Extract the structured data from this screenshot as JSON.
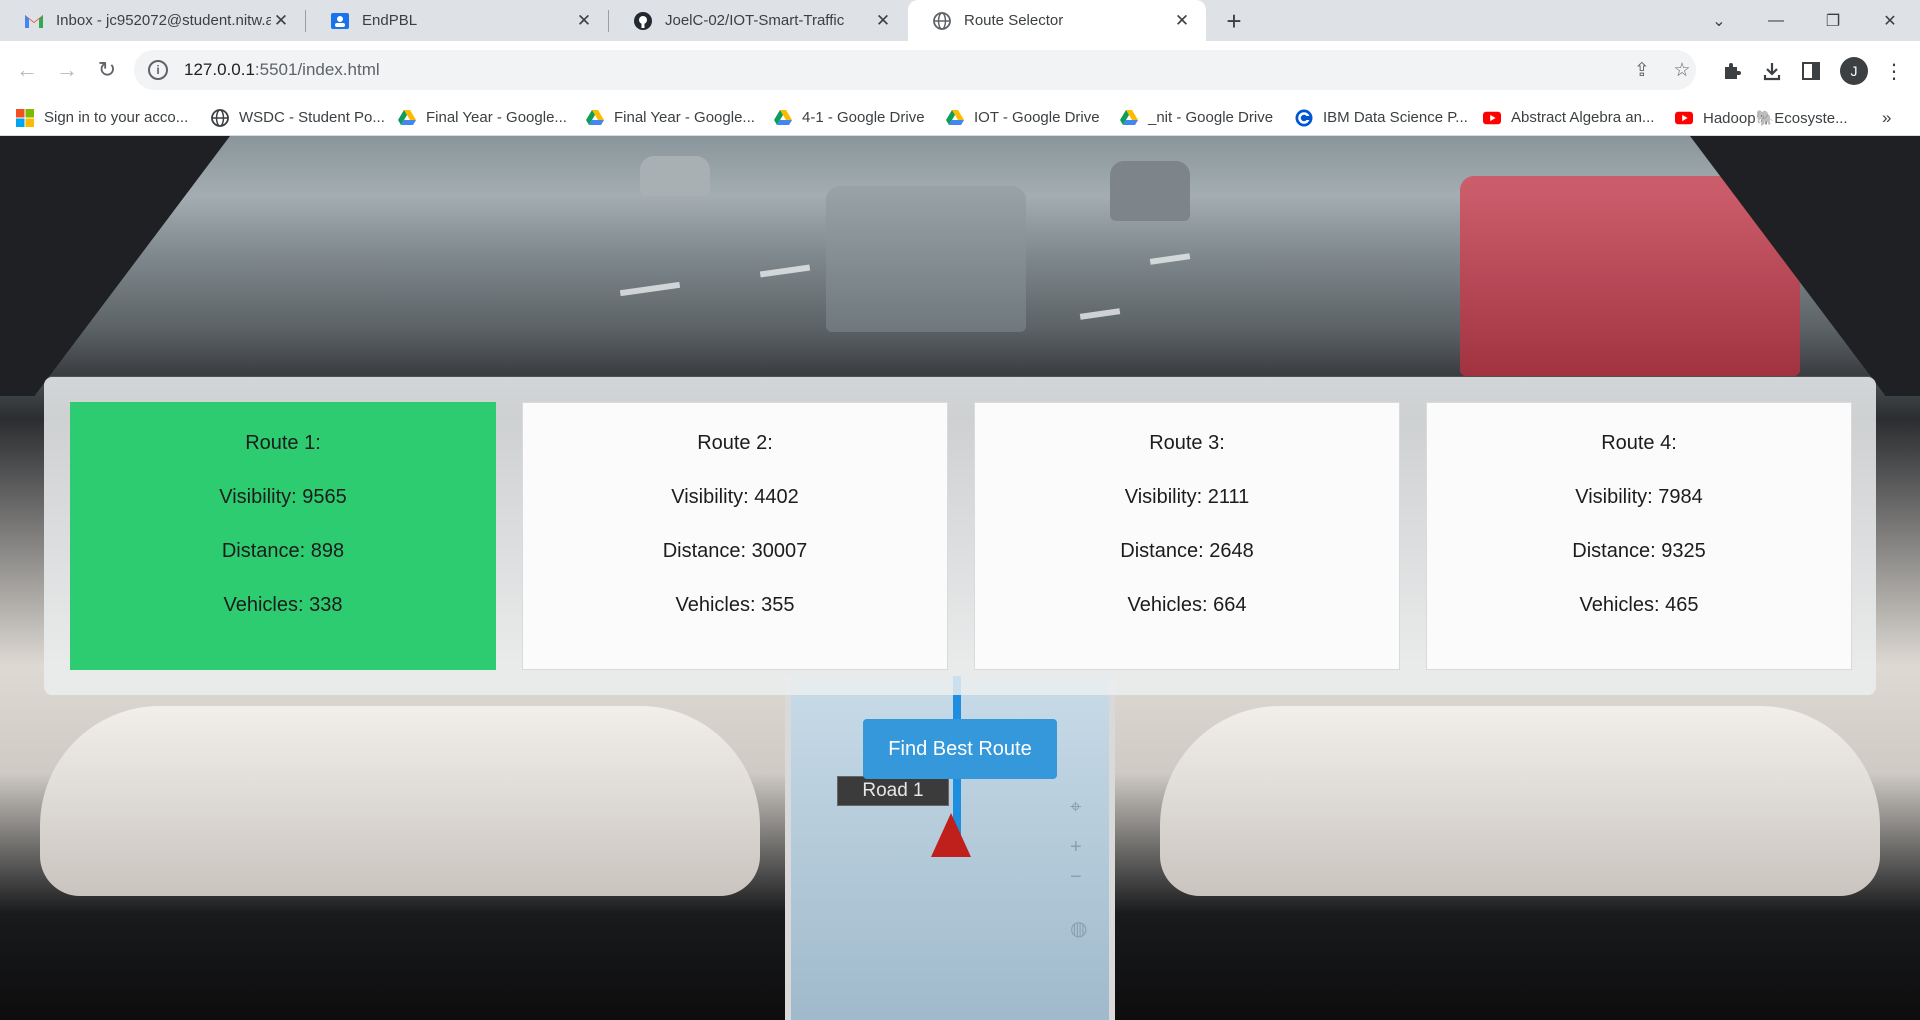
{
  "tabs": [
    {
      "title": "Inbox - jc952072@student.nitw.ac.in",
      "icon": "gmail-icon"
    },
    {
      "title": "EndPBL",
      "icon": "classroom-icon"
    },
    {
      "title": "JoelC-02/IOT-Smart-Traffic",
      "icon": "github-icon"
    },
    {
      "title": "Route Selector",
      "icon": "globe-icon",
      "active": true
    }
  ],
  "address": {
    "host": "127.0.0.1",
    "path": ":5501/index.html"
  },
  "profile_initial": "J",
  "bookmarks": [
    {
      "label": "Sign in to your acco...",
      "icon": "microsoft-icon"
    },
    {
      "label": "WSDC - Student Po...",
      "icon": "globe-icon"
    },
    {
      "label": "Final Year - Google...",
      "icon": "google-drive-icon"
    },
    {
      "label": "Final Year - Google...",
      "icon": "google-drive-icon"
    },
    {
      "label": "4-1 - Google Drive",
      "icon": "google-drive-icon"
    },
    {
      "label": "IOT - Google Drive",
      "icon": "google-drive-icon"
    },
    {
      "label": "_nit - Google Drive",
      "icon": "google-drive-icon"
    },
    {
      "label": "IBM Data Science P...",
      "icon": "coursera-icon"
    },
    {
      "label": "Abstract Algebra an...",
      "icon": "youtube-icon"
    },
    {
      "label": "Hadoop🐘Ecosyste...",
      "icon": "youtube-icon"
    }
  ],
  "routes": [
    {
      "title": "Route 1:",
      "visibility": "Visibility: 9565",
      "distance": "Distance: 898",
      "vehicles": "Vehicles: 338",
      "best": true
    },
    {
      "title": "Route 2:",
      "visibility": "Visibility: 4402",
      "distance": "Distance: 30007",
      "vehicles": "Vehicles: 355"
    },
    {
      "title": "Route 3:",
      "visibility": "Visibility: 2111",
      "distance": "Distance: 2648",
      "vehicles": "Vehicles: 664"
    },
    {
      "title": "Route 4:",
      "visibility": "Visibility: 7984",
      "distance": "Distance: 9325",
      "vehicles": "Vehicles: 465"
    }
  ],
  "find_button": "Find Best Route",
  "background": {
    "road_label": "Road 1"
  },
  "colors": {
    "best_route": "#2ecc71",
    "button": "#3498db"
  }
}
